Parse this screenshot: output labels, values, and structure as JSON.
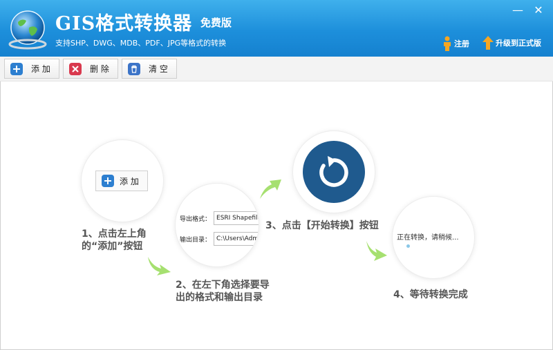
{
  "header": {
    "title": "GIS格式转换器",
    "edition": "免费版",
    "subtitle": "支持SHP、DWG、MDB、PDF、JPG等格式的转换",
    "register_label": "注册",
    "upgrade_label": "升级到正式版",
    "minimize_glyph": "—",
    "close_glyph": "✕"
  },
  "toolbar": {
    "add_label": "添 加",
    "delete_label": "删 除",
    "clear_label": "清 空"
  },
  "steps": {
    "step1_button_label": "添 加",
    "step1_line1": "1、点击左上角",
    "step1_line2": "的“添加”按钮",
    "step2_format_label": "导出格式：",
    "step2_format_value": "ESRI Shapefile",
    "step2_dir_label": "输出目录：",
    "step2_dir_value": "C:\\Users\\Adm",
    "step2_line1": "2、在左下角选择要导",
    "step2_line2": "出的格式和输出目录",
    "step3_text": "3、点击【开始转换】按钮",
    "step4_status": "正在转换，请稍候...",
    "step4_text": "4、等待转换完成"
  },
  "colors": {
    "header_blue": "#1d8fdb",
    "arrow_green": "#a6e070",
    "start_disc": "#1f5a8e",
    "add_icon": "#2d7fd0",
    "delete_icon": "#d9394e"
  },
  "icons": [
    "globe-logo-icon",
    "person-icon",
    "up-arrow-icon",
    "plus-icon",
    "x-icon",
    "trash-icon",
    "refresh-icon",
    "green-arrow-icon"
  ]
}
